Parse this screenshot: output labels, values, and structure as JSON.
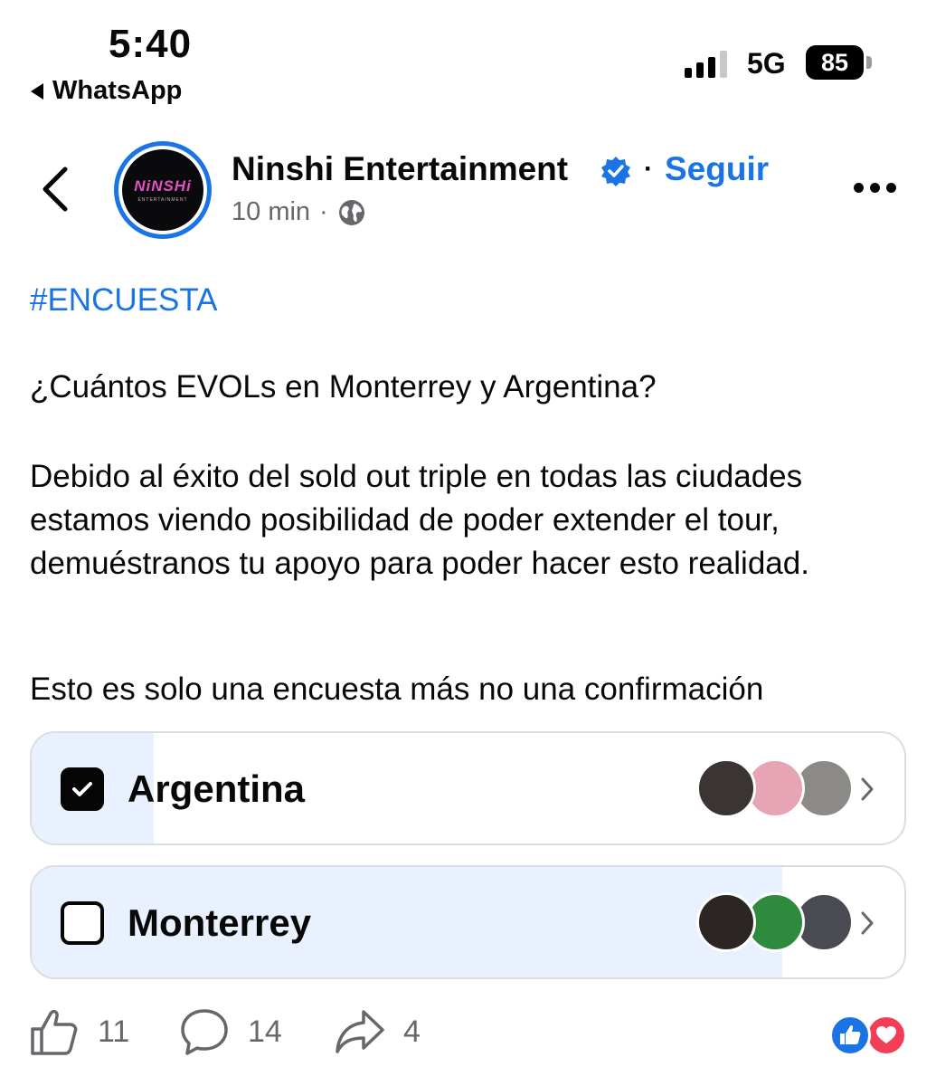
{
  "status_bar": {
    "time": "5:40",
    "back_app": "WhatsApp",
    "network": "5G",
    "battery": "85"
  },
  "post": {
    "page_name": "Ninshi Entertainment",
    "follow_label": "Seguir",
    "separator": "·",
    "time_ago": "10 min",
    "meta_dot": "·",
    "avatar_logo": "NiNSHi",
    "avatar_logo_sub": "ENTERTAINMENT",
    "hashtag": "#ENCUESTA",
    "question": "¿Cuántos EVOLs en Monterrey y Argentina?",
    "paragraph": "Debido al éxito del sold out triple en todas las ciudades estamos viendo posibilidad de poder extender el tour, demuéstranos tu apoyo para poder hacer esto realidad.",
    "disclaimer": "Esto es solo una encuesta más no una confirmación"
  },
  "poll": {
    "options": [
      {
        "label": "Argentina",
        "selected": true,
        "vote_share_fill": 0.14,
        "voter_avatars": [
          "#3a3432",
          "#e7a4b5",
          "#8c8a86"
        ]
      },
      {
        "label": "Monterrey",
        "selected": false,
        "vote_share_fill": 0.86,
        "voter_avatars": [
          "#2b2624",
          "#2e8b3e",
          "#4a4a52"
        ]
      }
    ]
  },
  "actions": {
    "like_count": "11",
    "comment_count": "14",
    "share_count": "4"
  },
  "colors": {
    "accent": "#1b74e4",
    "poll_fill": "#e8f1fd",
    "love": "#f33e58"
  },
  "icons": [
    "back-triangle-icon",
    "signal-icon",
    "back-chevron-icon",
    "verified-icon",
    "globe-icon",
    "more-icon",
    "checkbox-checked-icon",
    "checkbox-empty-icon",
    "chevron-right-icon",
    "like-icon",
    "comment-icon",
    "share-icon",
    "like-reaction-icon",
    "love-reaction-icon"
  ]
}
